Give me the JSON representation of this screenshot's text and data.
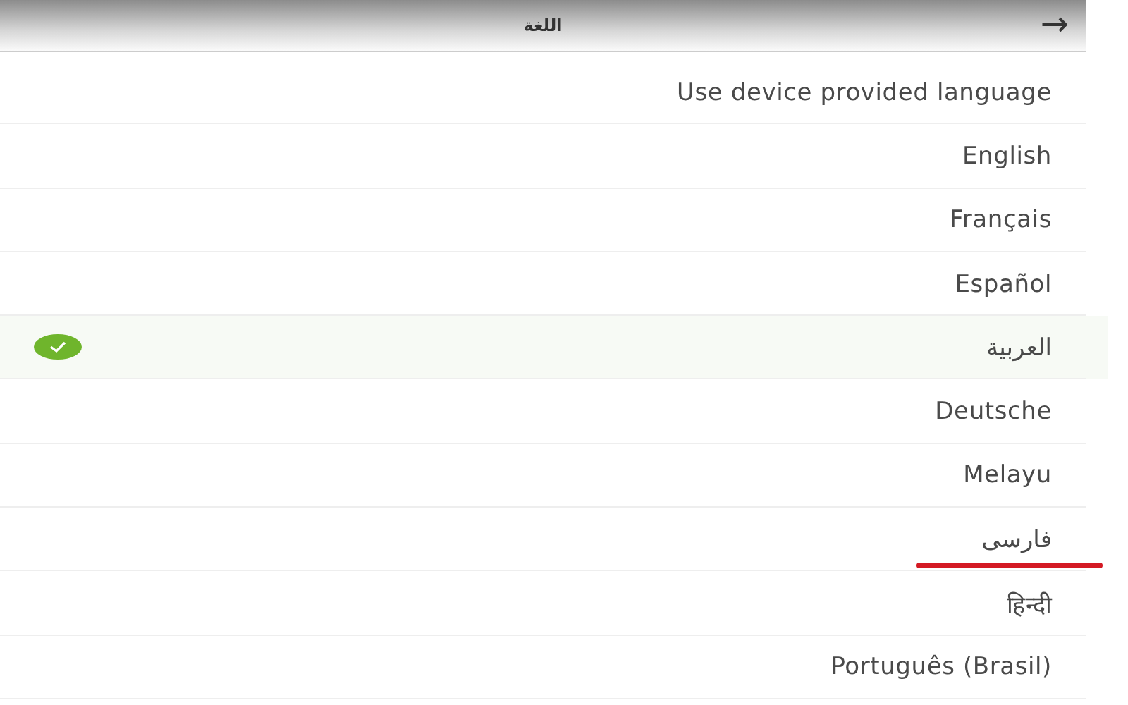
{
  "header": {
    "title": "اللغة",
    "back": "→"
  },
  "languages": [
    {
      "label": "Use device provided language",
      "selected": false,
      "underlined": false
    },
    {
      "label": "English",
      "selected": false,
      "underlined": false
    },
    {
      "label": "Français",
      "selected": false,
      "underlined": false
    },
    {
      "label": "Español",
      "selected": false,
      "underlined": false
    },
    {
      "label": "العربية",
      "selected": true,
      "underlined": false
    },
    {
      "label": "Deutsche",
      "selected": false,
      "underlined": false
    },
    {
      "label": "Melayu",
      "selected": false,
      "underlined": false
    },
    {
      "label": "فارسی",
      "selected": false,
      "underlined": true
    },
    {
      "label": "हिन्दी",
      "selected": false,
      "underlined": false
    },
    {
      "label": "Português (Brasil)",
      "selected": false,
      "underlined": false
    }
  ]
}
